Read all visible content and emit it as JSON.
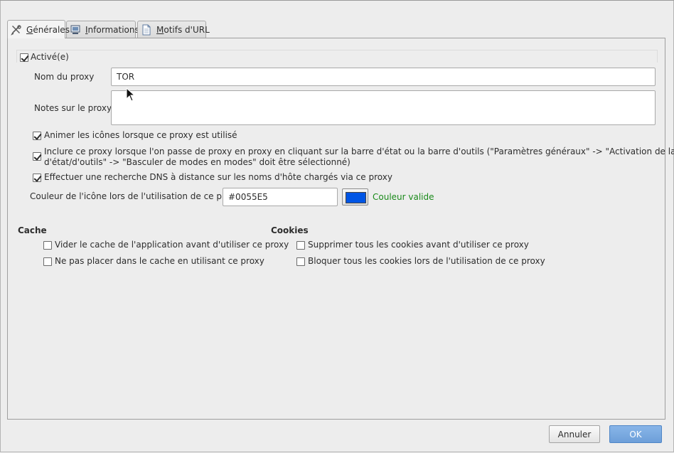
{
  "tabs": [
    {
      "label": "Générales",
      "underline_char": "G",
      "icon": "tools-icon",
      "active": true
    },
    {
      "label": "Informations",
      "underline_char": "I",
      "icon": "computer-icon",
      "active": false
    },
    {
      "label": "Motifs d'URL",
      "underline_char": "M",
      "icon": "document-icon",
      "active": false
    }
  ],
  "general": {
    "enabled_label": "Activé(e)",
    "enabled_checked": true,
    "proxy_name_label": "Nom du proxy",
    "proxy_name_value": "TOR",
    "proxy_notes_label": "Notes sur le proxy",
    "proxy_notes_value": "",
    "option_animate": "Animer les icônes lorsque ce proxy est utilisé",
    "option_include_line1": "Inclure ce proxy lorsque l'on passe de proxy en proxy en cliquant sur la barre d'état ou la barre d'outils (\"Paramètres généraux\" -> \"Activation de la barre",
    "option_include_line2": "d'état/d'outils\" -> \"Basculer de modes en modes\" doit être sélectionné)",
    "option_dns": "Effectuer une recherche DNS à distance sur les noms d'hôte chargés via ce proxy",
    "color_label": "Couleur de l'icône lors de l'utilisation de ce proxy",
    "color_value": "#0055E5",
    "color_swatch": "#0055e5",
    "color_status": "Couleur valide",
    "color_status_color": "#1a8a1a"
  },
  "cache": {
    "title": "Cache",
    "option_clear": "Vider le cache de l'application avant d'utiliser ce proxy",
    "option_no_cache": "Ne pas placer dans le cache en utilisant ce proxy"
  },
  "cookies": {
    "title": "Cookies",
    "option_delete": "Supprimer tous les cookies avant d'utiliser ce proxy",
    "option_block": "Bloquer tous les cookies lors de l'utilisation de ce proxy"
  },
  "buttons": {
    "cancel": "Annuler",
    "ok": "OK"
  }
}
